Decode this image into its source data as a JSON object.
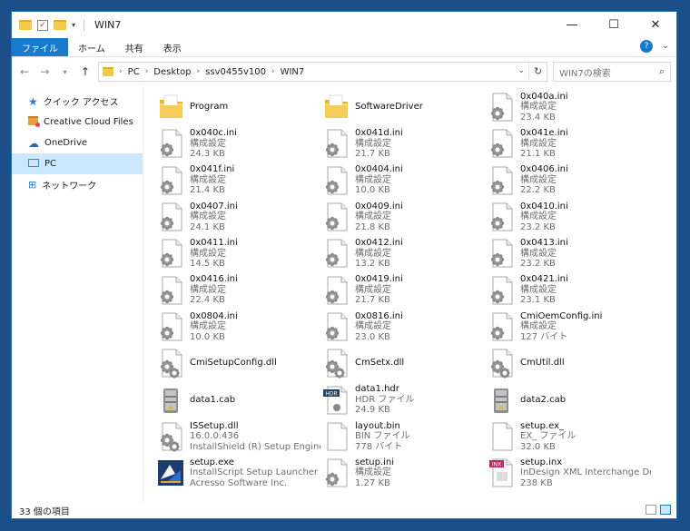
{
  "window": {
    "title": "WIN7"
  },
  "ribbon": {
    "tabs": [
      "ファイル",
      "ホーム",
      "共有",
      "表示"
    ],
    "help": "?"
  },
  "address": {
    "crumbs": [
      "PC",
      "Desktop",
      "ssv0455v100",
      "WIN7"
    ],
    "search_placeholder": "WIN7の検索"
  },
  "sidebar": {
    "items": [
      {
        "label": "クイック アクセス",
        "icon": "star-icon"
      },
      {
        "label": "Creative Cloud Files",
        "icon": "creative-cloud-folder-icon"
      },
      {
        "label": "OneDrive",
        "icon": "cloud-icon"
      },
      {
        "label": "PC",
        "icon": "computer-icon",
        "selected": true
      },
      {
        "label": "ネットワーク",
        "icon": "network-icon"
      }
    ]
  },
  "files": [
    {
      "name": "Program",
      "sub1": "",
      "sub2": "",
      "icon": "folder-icon"
    },
    {
      "name": "SoftwareDriver",
      "sub1": "",
      "sub2": "",
      "icon": "folder-icon"
    },
    {
      "name": "0x040a.ini",
      "sub1": "構成設定",
      "sub2": "23.4 KB",
      "icon": "ini-file-icon"
    },
    {
      "name": "0x040c.ini",
      "sub1": "構成設定",
      "sub2": "24.3 KB",
      "icon": "ini-file-icon"
    },
    {
      "name": "0x041d.ini",
      "sub1": "構成設定",
      "sub2": "21.7 KB",
      "icon": "ini-file-icon"
    },
    {
      "name": "0x041e.ini",
      "sub1": "構成設定",
      "sub2": "21.1 KB",
      "icon": "ini-file-icon"
    },
    {
      "name": "0x041f.ini",
      "sub1": "構成設定",
      "sub2": "21.4 KB",
      "icon": "ini-file-icon"
    },
    {
      "name": "0x0404.ini",
      "sub1": "構成設定",
      "sub2": "10.0 KB",
      "icon": "ini-file-icon"
    },
    {
      "name": "0x0406.ini",
      "sub1": "構成設定",
      "sub2": "22.2 KB",
      "icon": "ini-file-icon"
    },
    {
      "name": "0x0407.ini",
      "sub1": "構成設定",
      "sub2": "24.1 KB",
      "icon": "ini-file-icon"
    },
    {
      "name": "0x0409.ini",
      "sub1": "構成設定",
      "sub2": "21.8 KB",
      "icon": "ini-file-icon"
    },
    {
      "name": "0x0410.ini",
      "sub1": "構成設定",
      "sub2": "23.2 KB",
      "icon": "ini-file-icon"
    },
    {
      "name": "0x0411.ini",
      "sub1": "構成設定",
      "sub2": "14.5 KB",
      "icon": "ini-file-icon"
    },
    {
      "name": "0x0412.ini",
      "sub1": "構成設定",
      "sub2": "13.2 KB",
      "icon": "ini-file-icon"
    },
    {
      "name": "0x0413.ini",
      "sub1": "構成設定",
      "sub2": "23.2 KB",
      "icon": "ini-file-icon"
    },
    {
      "name": "0x0416.ini",
      "sub1": "構成設定",
      "sub2": "22.4 KB",
      "icon": "ini-file-icon"
    },
    {
      "name": "0x0419.ini",
      "sub1": "構成設定",
      "sub2": "21.7 KB",
      "icon": "ini-file-icon"
    },
    {
      "name": "0x0421.ini",
      "sub1": "構成設定",
      "sub2": "23.1 KB",
      "icon": "ini-file-icon"
    },
    {
      "name": "0x0804.ini",
      "sub1": "構成設定",
      "sub2": "10.0 KB",
      "icon": "ini-file-icon"
    },
    {
      "name": "0x0816.ini",
      "sub1": "構成設定",
      "sub2": "23.0 KB",
      "icon": "ini-file-icon"
    },
    {
      "name": "CmiOemConfig.ini",
      "sub1": "構成設定",
      "sub2": "127 バイト",
      "icon": "ini-file-icon"
    },
    {
      "name": "CmiSetupConfig.dll",
      "sub1": "",
      "sub2": "",
      "icon": "dll-file-icon"
    },
    {
      "name": "CmSetx.dll",
      "sub1": "",
      "sub2": "",
      "icon": "dll-file-icon"
    },
    {
      "name": "CmUtil.dll",
      "sub1": "",
      "sub2": "",
      "icon": "dll-file-icon"
    },
    {
      "name": "data1.cab",
      "sub1": "",
      "sub2": "",
      "icon": "cab-file-icon"
    },
    {
      "name": "data1.hdr",
      "sub1": "HDR ファイル",
      "sub2": "24.9 KB",
      "icon": "hdr-file-icon"
    },
    {
      "name": "data2.cab",
      "sub1": "",
      "sub2": "",
      "icon": "cab-file-icon"
    },
    {
      "name": "ISSetup.dll",
      "sub1": "16.0.0.436",
      "sub2": "InstallShield (R) Setup Engine",
      "icon": "dll-file-icon"
    },
    {
      "name": "layout.bin",
      "sub1": "BIN ファイル",
      "sub2": "778 バイト",
      "icon": "blank-file-icon"
    },
    {
      "name": "setup.ex_",
      "sub1": "EX_ ファイル",
      "sub2": "32.0 KB",
      "icon": "blank-file-icon"
    },
    {
      "name": "setup.exe",
      "sub1": "InstallScript Setup Launcher",
      "sub2": "Acresso Software Inc.",
      "icon": "setup-exe-icon"
    },
    {
      "name": "setup.ini",
      "sub1": "構成設定",
      "sub2": "1.27 KB",
      "icon": "ini-file-icon"
    },
    {
      "name": "setup.inx",
      "sub1": "InDesign XML Interchange Docu...",
      "sub2": "238 KB",
      "icon": "inx-file-icon"
    }
  ],
  "status": {
    "count_text": "33 個の項目"
  }
}
